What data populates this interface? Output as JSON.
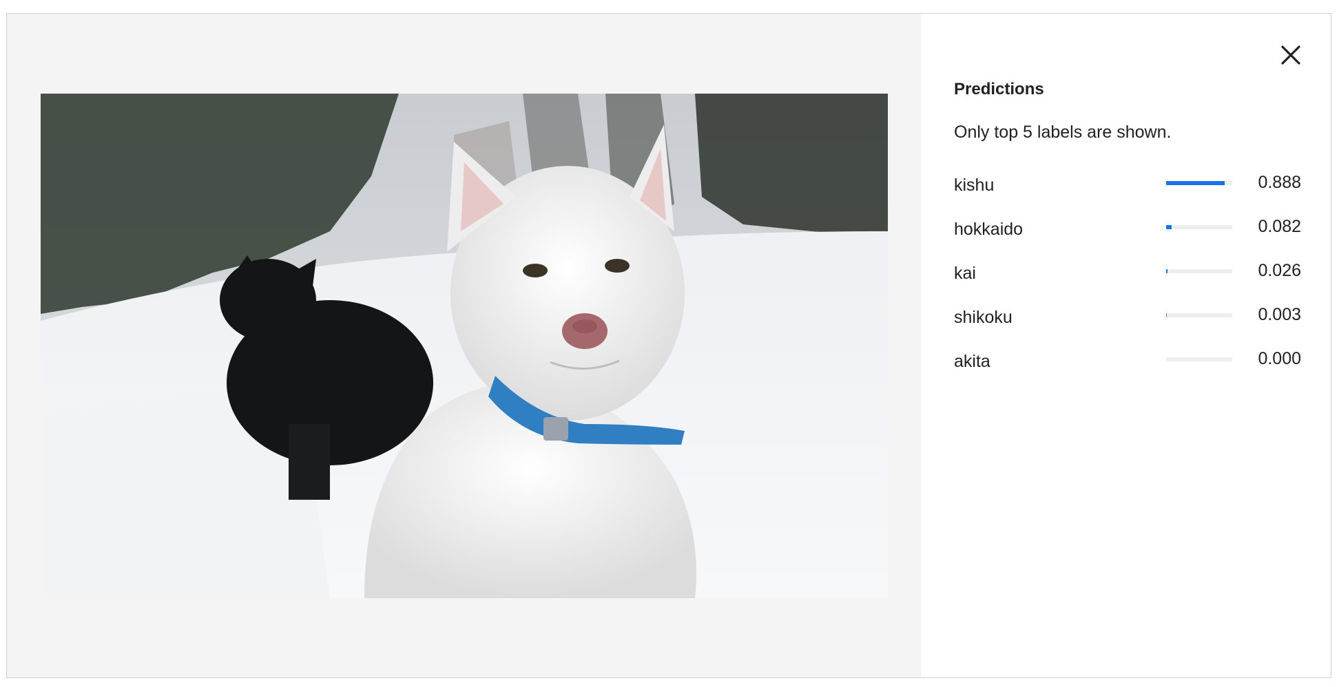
{
  "panel": {
    "title": "Predictions",
    "note": "Only top 5 labels are shown.",
    "close_icon": "close-icon"
  },
  "image": {
    "subject_icon": "photo"
  },
  "predictions": [
    {
      "label": "kishu",
      "value": "0.888",
      "score": 0.888
    },
    {
      "label": "hokkaido",
      "value": "0.082",
      "score": 0.082
    },
    {
      "label": "kai",
      "value": "0.026",
      "score": 0.026
    },
    {
      "label": "shikoku",
      "value": "0.003",
      "score": 0.003
    },
    {
      "label": "akita",
      "value": "0.000",
      "score": 0.0
    }
  ],
  "colors": {
    "bar_fill": "#1a73e8",
    "bar_track": "#eeeeee",
    "image_pane_bg": "#f4f4f4"
  }
}
